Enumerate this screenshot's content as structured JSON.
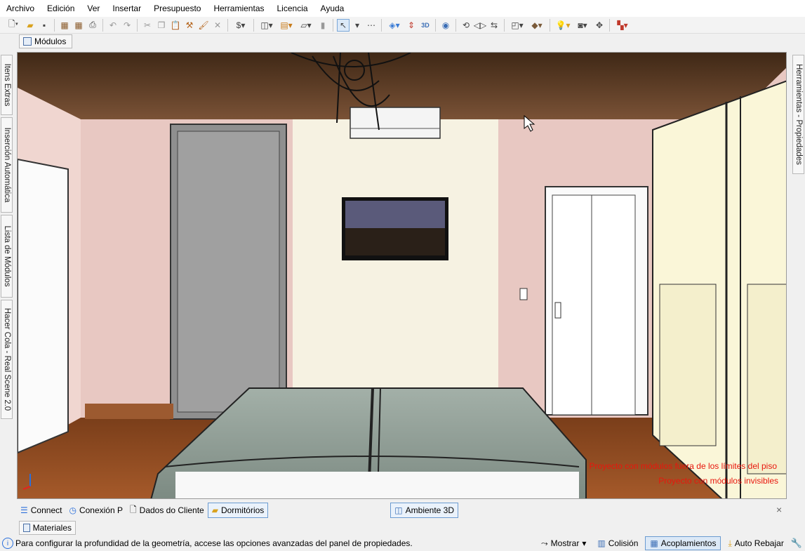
{
  "menu": [
    "Archivo",
    "Edición",
    "Ver",
    "Insertar",
    "Presupuesto",
    "Herramientas",
    "Licencia",
    "Ayuda"
  ],
  "toolbar_icons": [
    "new-icon",
    "open-icon",
    "save-icon",
    "print-icon",
    "print-preview-icon",
    "printer-icon",
    "undo-icon",
    "redo-icon",
    "cut-icon",
    "copy-icon",
    "paste-icon",
    "hammer-icon",
    "paint-roller-icon",
    "delete-icon",
    "budget-icon",
    "module-icon",
    "bricks-icon",
    "shape-icon",
    "panel-icon",
    "select-arrow-icon",
    "measure-icon",
    "layers-icon",
    "dimensions-icon",
    "3d-icon",
    "eye-icon",
    "rotate-icon",
    "flip-icon",
    "view-box-icon",
    "cube-icon",
    "light-icon",
    "camera-icon",
    "move-icon",
    "color-palette-icon"
  ],
  "modulos_tab": "Módulos",
  "left_tabs": [
    "Itens Extras",
    "Inserción Automática",
    "Lista de Módulos",
    "Hacer Cola - Real Scene 2.0"
  ],
  "right_tab": "Herramientas - Propiedades",
  "scene": {
    "warnings": [
      "Proyecto con módulos fuera de los límites del piso",
      "Proyecto con módulos invisibles"
    ],
    "colors": {
      "wall": "#e8c8c2",
      "ceiling": "#5a3a24",
      "floor": "#8a4a22",
      "accent_wall": "#f6f2e2",
      "bed": "#8f9e96"
    }
  },
  "doc_tabs": [
    "Connect",
    "Conexión P",
    "Dados do Cliente",
    "Dormitórios"
  ],
  "active_doc_tab": "Dormitórios",
  "view_tab": "Ambiente 3D",
  "close_symbol": "×",
  "materiales_tab": "Materiales",
  "status": {
    "message": "Para configurar la profundidad de la geometría, accese las opciones avanzadas del panel de propiedades.",
    "mostrar": "Mostrar",
    "colision": "Colisión",
    "acoplamientos": "Acoplamientos",
    "auto_rebajar": "Auto Rebajar"
  }
}
